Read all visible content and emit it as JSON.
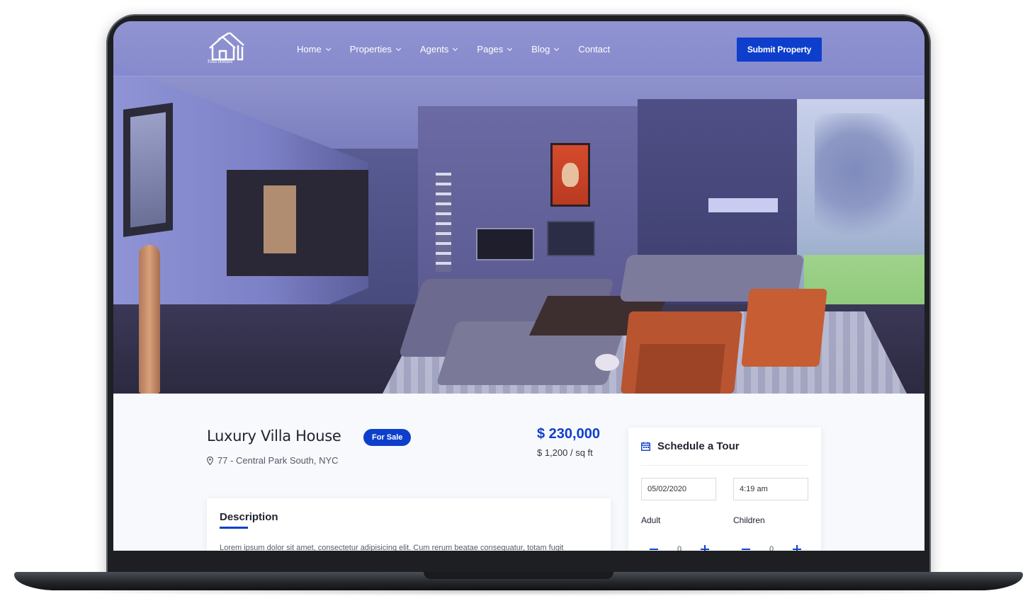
{
  "nav": {
    "logo_text": "Find Houses",
    "items": [
      {
        "label": "Home",
        "has_dropdown": true
      },
      {
        "label": "Properties",
        "has_dropdown": true
      },
      {
        "label": "Agents",
        "has_dropdown": true
      },
      {
        "label": "Pages",
        "has_dropdown": true
      },
      {
        "label": "Blog",
        "has_dropdown": true
      },
      {
        "label": "Contact",
        "has_dropdown": false
      }
    ],
    "submit_label": "Submit Property"
  },
  "property": {
    "title": "Luxury Villa House",
    "status_badge": "For Sale",
    "address": "77 - Central Park South, NYC",
    "price": "$ 230,000",
    "price_per_sqft": "$ 1,200 / sq ft"
  },
  "description": {
    "heading": "Description",
    "text": "Lorem ipsum dolor sit amet, consectetur adipisicing elit. Cum rerum beatae consequatur, totam fugit"
  },
  "tour": {
    "heading": "Schedule a Tour",
    "date_value": "05/02/2020",
    "time_value": "4:19 am",
    "adult_label": "Adult",
    "adult_count": "0",
    "children_label": "Children",
    "children_count": "0"
  },
  "colors": {
    "accent": "#0e3fcc",
    "text_dark": "#222431",
    "page_bg": "#f7f9fc"
  },
  "icons": [
    "house-logo-icon",
    "chevron-down-icon",
    "map-pin-icon",
    "calendar-icon",
    "minus-icon",
    "plus-icon"
  ]
}
